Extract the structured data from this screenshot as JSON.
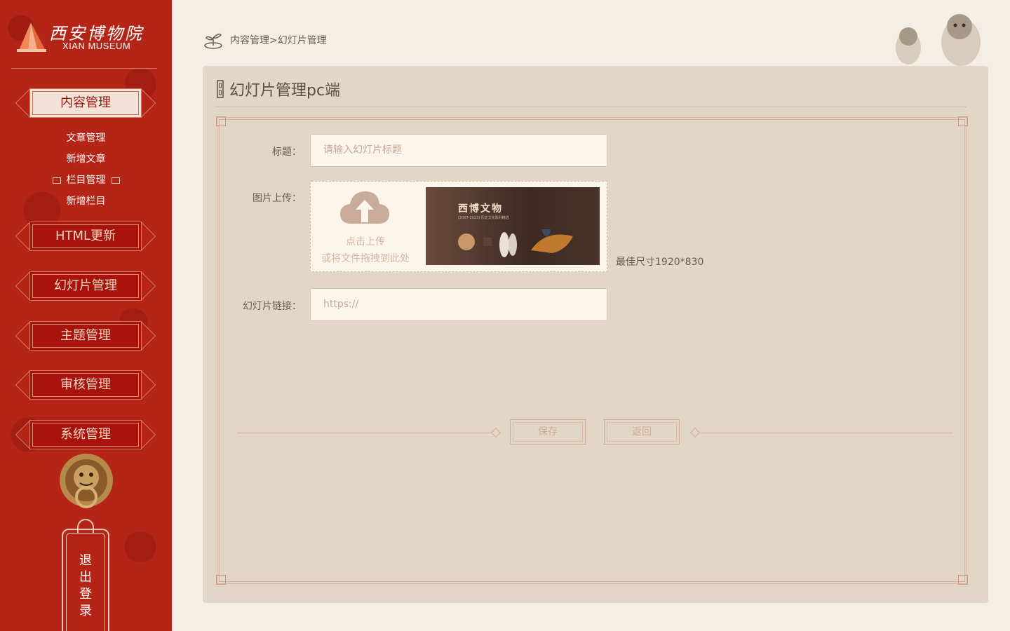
{
  "brand": {
    "name_cn": "西安博物院",
    "name_en": "XIAN MUSEUM"
  },
  "sidebar": {
    "active_section": "内容管理",
    "submenu": [
      {
        "label": "文章管理"
      },
      {
        "label": "新增文章"
      },
      {
        "label": "栏目管理"
      },
      {
        "label": "新增栏目"
      }
    ],
    "sections": [
      {
        "label": "HTML更新"
      },
      {
        "label": "幻灯片管理"
      },
      {
        "label": "主题管理"
      },
      {
        "label": "审核管理"
      },
      {
        "label": "系统管理"
      }
    ],
    "logout": "退\n出\n登\n录"
  },
  "breadcrumb": {
    "text": "内容管理>幻灯片管理"
  },
  "panel": {
    "title": "幻灯片管理pc端",
    "form": {
      "title_label": "标题：",
      "title_placeholder": "请输入幻灯片标题",
      "image_label": "图片上传：",
      "upload_line1": "点击上传",
      "upload_line2": "或将文件拖拽到此处",
      "preview_title": "西博文物",
      "preview_subtitle": "(2007-2023) 历史文化陈列精选",
      "size_hint": "最佳尺寸1920*830",
      "link_label": "幻灯片链接：",
      "link_placeholder": "https://"
    },
    "actions": {
      "save": "保存",
      "back": "返回"
    }
  },
  "colors": {
    "sidebar_red": "#b52517",
    "panel_bg": "#e2d6c6",
    "input_bg": "#fcf5e9"
  }
}
